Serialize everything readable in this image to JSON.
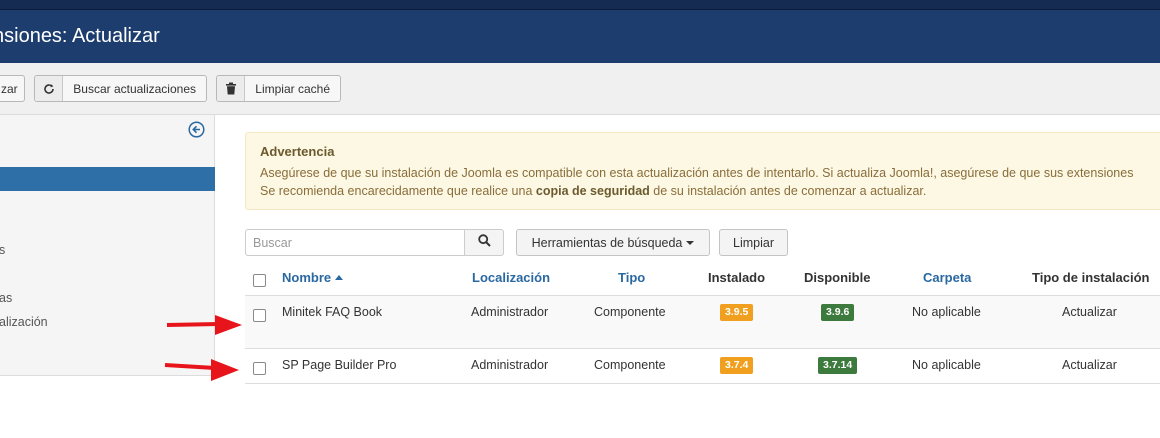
{
  "header": {
    "title": "nsiones: Actualizar"
  },
  "toolbar": {
    "update_label": "zar",
    "check_updates_label": "Buscar actualizaciones",
    "clear_cache_label": "Limpiar caché"
  },
  "sidebar": {
    "items": [
      "s",
      "as",
      "alización"
    ]
  },
  "alert": {
    "heading": "Advertencia",
    "line1": "Asegúrese de que su instalación de Joomla es compatible con esta actualización antes de intentarlo. Si actualiza Joomla!, asegúrese de que sus extensiones",
    "line2_pre": "Se recomienda encarecidamente que realice una ",
    "line2_bold": "copia de seguridad",
    "line2_post": " de su instalación antes de comenzar a actualizar."
  },
  "filters": {
    "search_placeholder": "Buscar",
    "tools_label": "Herramientas de búsqueda",
    "clear_label": "Limpiar"
  },
  "table": {
    "columns": {
      "name": "Nombre",
      "location": "Localización",
      "type": "Tipo",
      "installed": "Instalado",
      "available": "Disponible",
      "folder": "Carpeta",
      "install_type": "Tipo de instalación"
    },
    "rows": [
      {
        "name": "Minitek FAQ Book",
        "location": "Administrador",
        "type": "Componente",
        "installed": "3.9.5",
        "available": "3.9.6",
        "folder": "No aplicable",
        "install_type": "Actualizar"
      },
      {
        "name": "SP Page Builder Pro",
        "location": "Administrador",
        "type": "Componente",
        "installed": "3.7.4",
        "available": "3.7.14",
        "folder": "No aplicable",
        "install_type": "Actualizar"
      }
    ]
  },
  "colors": {
    "header_bg": "#1c3d6e",
    "sidebar_active": "#2f6fa8",
    "badge_installed": "#f0a01e",
    "badge_available": "#3d7a3d",
    "annotation_arrow": "#e8141c"
  },
  "icons": [
    "refresh-icon",
    "trash-icon",
    "collapse-left-icon",
    "search-icon",
    "sort-up-icon",
    "red-arrow-annotation"
  ]
}
